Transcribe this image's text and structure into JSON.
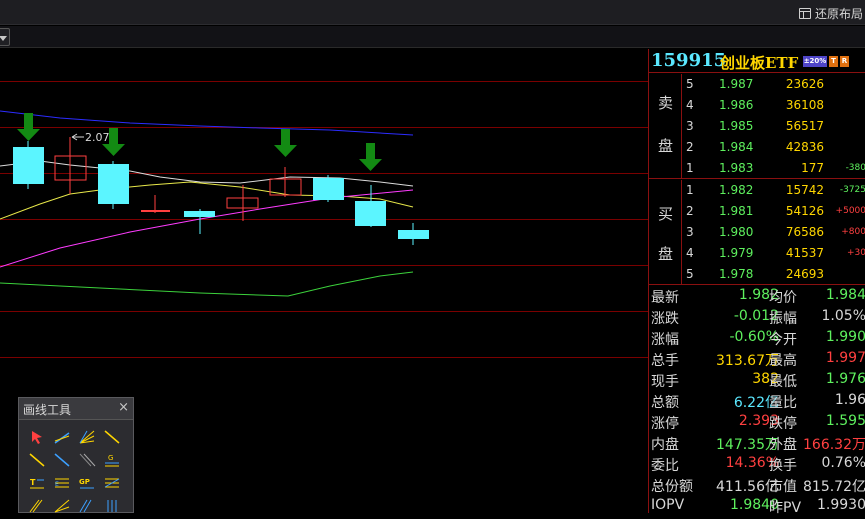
{
  "toolbar": {
    "restore_label": "还原布局"
  },
  "quote": {
    "code": "159915",
    "name": "创业板ETF",
    "limit_tag": "±20%",
    "tag_t": "T",
    "tag_r": "R",
    "sell_label_1": "卖",
    "sell_label_2": "盘",
    "buy_label_1": "买",
    "buy_label_2": "盘",
    "sell": [
      {
        "level": "5",
        "price": "1.987",
        "volume": "23626",
        "change": ""
      },
      {
        "level": "4",
        "price": "1.986",
        "volume": "36108",
        "change": ""
      },
      {
        "level": "3",
        "price": "1.985",
        "volume": "56517",
        "change": ""
      },
      {
        "level": "2",
        "price": "1.984",
        "volume": "42836",
        "change": ""
      },
      {
        "level": "1",
        "price": "1.983",
        "volume": "177",
        "change": "-380"
      }
    ],
    "buy": [
      {
        "level": "1",
        "price": "1.982",
        "volume": "15742",
        "change": "-3725"
      },
      {
        "level": "2",
        "price": "1.981",
        "volume": "54126",
        "change": "+5000"
      },
      {
        "level": "3",
        "price": "1.980",
        "volume": "76586",
        "change": "+800"
      },
      {
        "level": "4",
        "price": "1.979",
        "volume": "41537",
        "change": "+30"
      },
      {
        "level": "5",
        "price": "1.978",
        "volume": "24693",
        "change": ""
      }
    ],
    "stats": [
      {
        "l1": "最新",
        "v1": "1.982",
        "c1": "g",
        "l2": "均价",
        "v2": "1.984",
        "c2": "g"
      },
      {
        "l1": "涨跌",
        "v1": "-0.012",
        "c1": "g",
        "l2": "振幅",
        "v2": "1.05%",
        "c2": "w"
      },
      {
        "l1": "涨幅",
        "v1": "-0.60%",
        "c1": "g",
        "l2": "今开",
        "v2": "1.990",
        "c2": "g"
      },
      {
        "l1": "总手",
        "v1": "313.67万",
        "c1": "y",
        "l2": "最高",
        "v2": "1.997",
        "c2": "r"
      },
      {
        "l1": "现手",
        "v1": "382",
        "c1": "y",
        "l2": "最低",
        "v2": "1.976",
        "c2": "g"
      },
      {
        "l1": "总额",
        "v1": "6.22亿",
        "c1": "c",
        "l2": "量比",
        "v2": "1.96",
        "c2": "w"
      },
      {
        "l1": "涨停",
        "v1": "2.393",
        "c1": "r",
        "l2": "跌停",
        "v2": "1.595",
        "c2": "g"
      },
      {
        "l1": "内盘",
        "v1": "147.35万",
        "c1": "g",
        "l2": "外盘",
        "v2": "166.32万",
        "c2": "r"
      },
      {
        "l1": "委比",
        "v1": "14.36%",
        "c1": "r",
        "l2": "换手",
        "v2": "0.76%",
        "c2": "w"
      },
      {
        "l1": "总份额",
        "v1": "411.56亿",
        "c1": "w",
        "l2": "市值",
        "v2": "815.72亿",
        "c2": "w"
      },
      {
        "l1": "IOPV",
        "v1": "1.9840",
        "c1": "g",
        "l2": "昨PV",
        "v2": "1.9930",
        "c2": "w"
      }
    ]
  },
  "chart": {
    "annotation": "2.07",
    "colors": {
      "up": "#ff4040",
      "down": "#5bf5ff",
      "arrow": "#138a13",
      "ma_blue": "#2c2cff",
      "ma_white": "#dcdcdc",
      "ma_yellow": "#e8e84a",
      "ma_magenta": "#ff3cff",
      "ma_green": "#3cd23c"
    }
  },
  "draw_tool": {
    "title": "画线工具",
    "close": "×",
    "tools": [
      "arrow-select-icon",
      "ray-line-icon",
      "fan-lines-icon",
      "segment-line-icon",
      "trend-line-icon",
      "extended-line-icon",
      "parallel-line-icon",
      "gann-line-icon",
      "text-tool-icon",
      "regression-icon",
      "gp-tool-icon",
      "wave-icon",
      "channel-icon",
      "triangle-icon",
      "arc-icon",
      "grid-icon"
    ]
  }
}
